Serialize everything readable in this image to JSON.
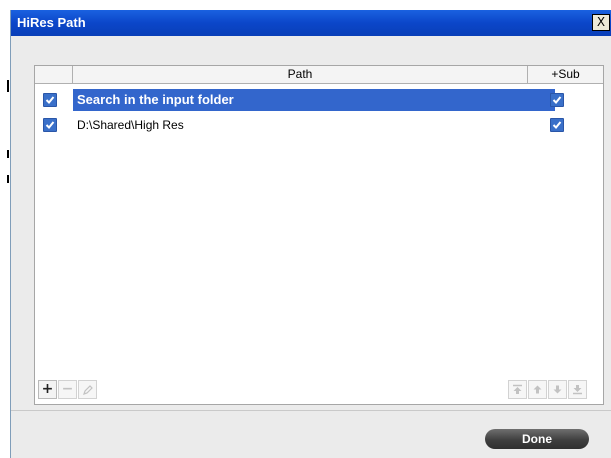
{
  "window": {
    "title": "HiRes Path",
    "close_label": "X"
  },
  "table": {
    "columns": {
      "check": "",
      "path": "Path",
      "sub": "+Sub"
    },
    "rows": [
      {
        "path": "Search in the input folder",
        "checked": true,
        "sub": true,
        "selected": true
      },
      {
        "path": "D:\\Shared\\High Res",
        "checked": true,
        "sub": true,
        "selected": false
      }
    ]
  },
  "toolbar": {
    "add": "+",
    "remove": "−",
    "edit_icon": "pencil-icon",
    "move_top_icon": "move-to-top-icon",
    "move_up_icon": "move-up-icon",
    "move_down_icon": "move-down-icon",
    "move_bottom_icon": "move-to-bottom-icon"
  },
  "footer": {
    "done_label": "Done"
  },
  "colors": {
    "title_bar": "#0b46c9",
    "selection": "#3366cc",
    "checkbox": "#3a70c9",
    "done_button": "#3f3f3f"
  }
}
